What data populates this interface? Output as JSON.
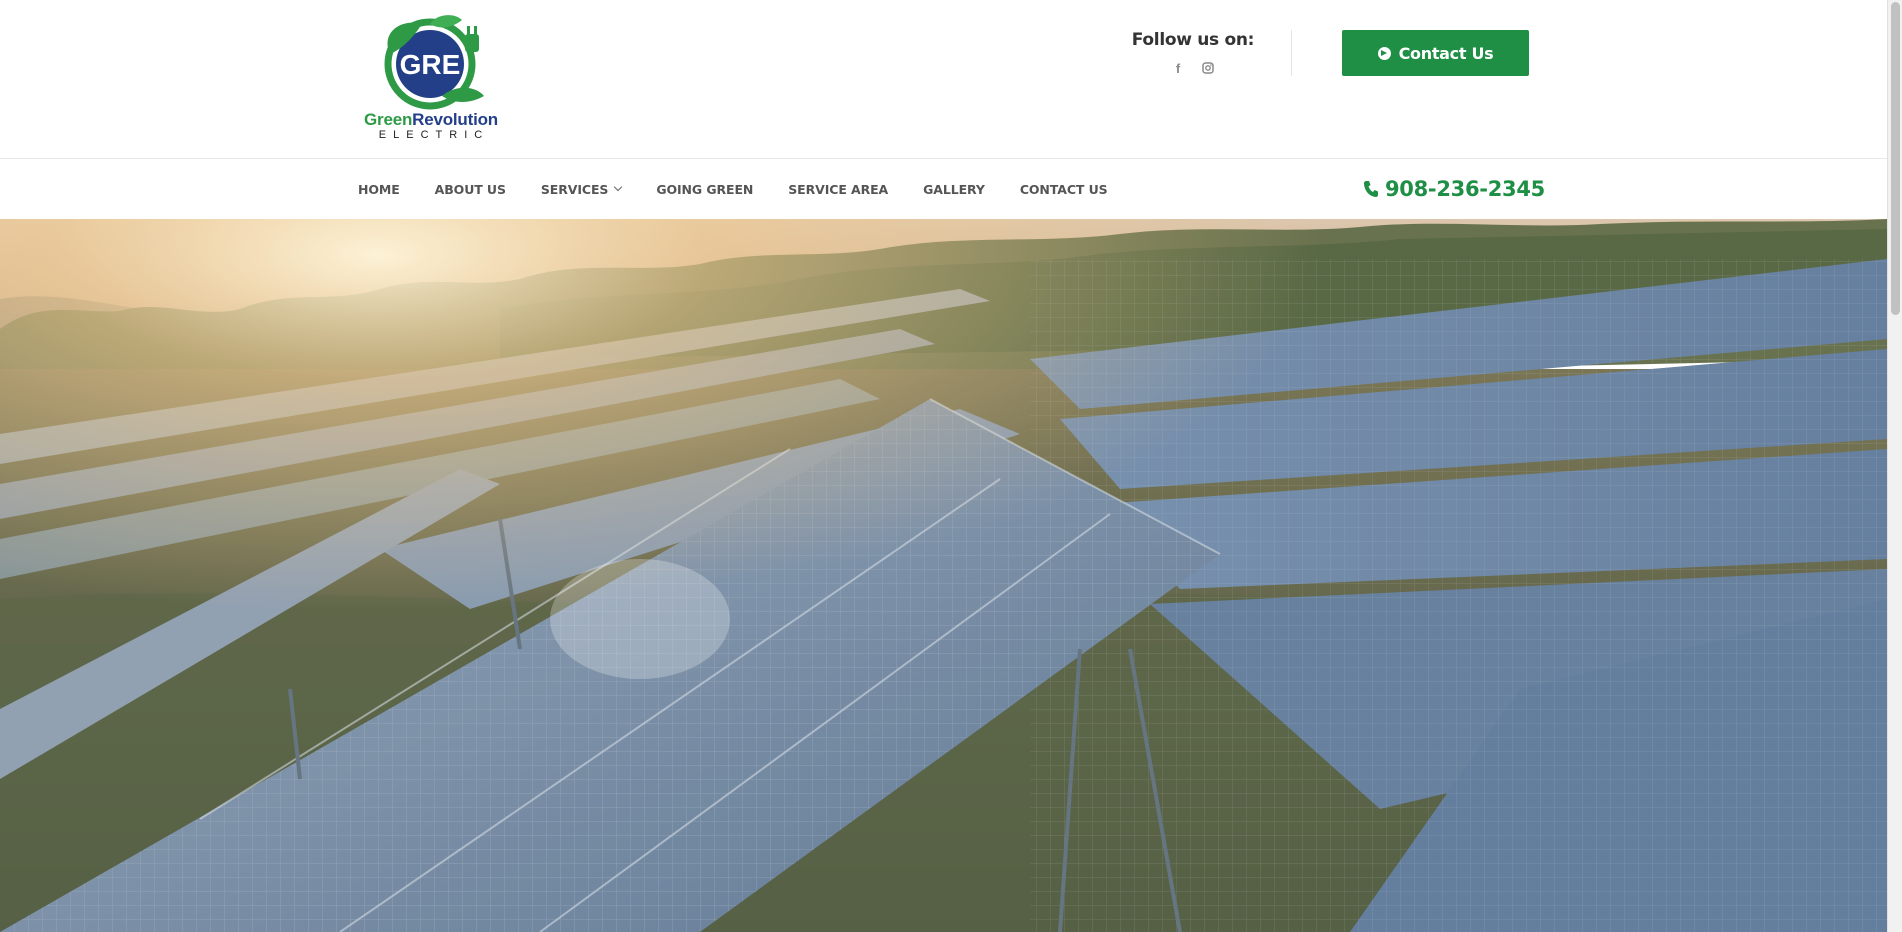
{
  "brand": {
    "name_green": "Green",
    "name_blue": "Revolution",
    "subtitle": "ELECTRIC",
    "monogram": "GRE",
    "colors": {
      "green": "#2f9a46",
      "blue": "#233f88"
    }
  },
  "header": {
    "follow_label": "Follow us on:",
    "social": [
      {
        "icon": "facebook-icon",
        "glyph": "f"
      },
      {
        "icon": "instagram-icon",
        "glyph": "◻"
      }
    ],
    "contact_button": {
      "label": "Contact Us",
      "icon": "arrow-circle-right-icon",
      "color": "#1e8f45"
    }
  },
  "nav": {
    "items": [
      {
        "label": "HOME"
      },
      {
        "label": "ABOUT US"
      },
      {
        "label": "SERVICES",
        "has_dropdown": true
      },
      {
        "label": "GOING GREEN"
      },
      {
        "label": "SERVICE AREA"
      },
      {
        "label": "GALLERY"
      },
      {
        "label": "CONTACT US"
      }
    ],
    "phone": {
      "number": "908-236-2345",
      "icon": "phone-icon"
    }
  },
  "hero": {
    "image": "solar-panels-field-at-sunrise"
  }
}
